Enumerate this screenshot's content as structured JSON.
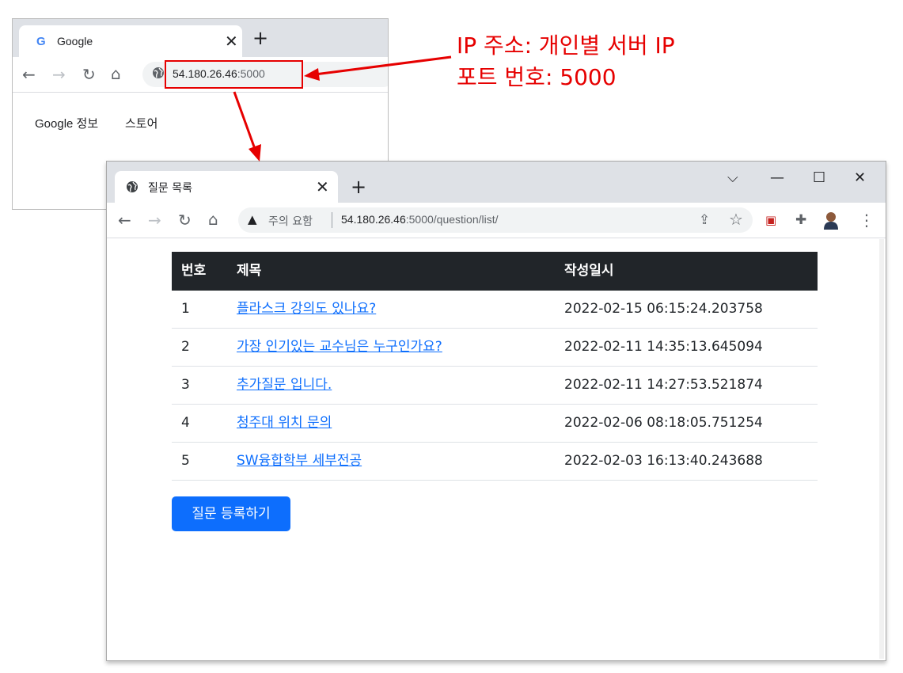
{
  "back_window": {
    "tab_title": "Google",
    "url_host": "54.180.26.46",
    "url_port": ":5000",
    "links": [
      "Google 정보",
      "스토어"
    ]
  },
  "annotation": {
    "line1": "IP 주소: 개인별 서버 IP",
    "line2": "포트 번호: 5000",
    "color": "#e60000"
  },
  "front_window": {
    "tab_title": "질문 목록",
    "security_label": "주의 요함",
    "url_host": "54.180.26.46",
    "url_rest": ":5000/question/list/",
    "table": {
      "headers": [
        "번호",
        "제목",
        "작성일시"
      ],
      "rows": [
        {
          "num": "1",
          "title": "플라스크 강의도 있나요?",
          "date": "2022-02-15 06:15:24.203758"
        },
        {
          "num": "2",
          "title": "가장 인기있는 교수님은 누구인가요?",
          "date": "2022-02-11 14:35:13.645094"
        },
        {
          "num": "3",
          "title": "추가질문 입니다.",
          "date": "2022-02-11 14:27:53.521874"
        },
        {
          "num": "4",
          "title": "청주대 위치 문의",
          "date": "2022-02-06 08:18:05.751254"
        },
        {
          "num": "5",
          "title": "SW융합학부 세부전공",
          "date": "2022-02-03 16:13:40.243688"
        }
      ]
    },
    "create_button": "질문 등록하기",
    "colors": {
      "header_bg": "#212529",
      "link": "#0d6efd",
      "button": "#0d6efd"
    }
  }
}
